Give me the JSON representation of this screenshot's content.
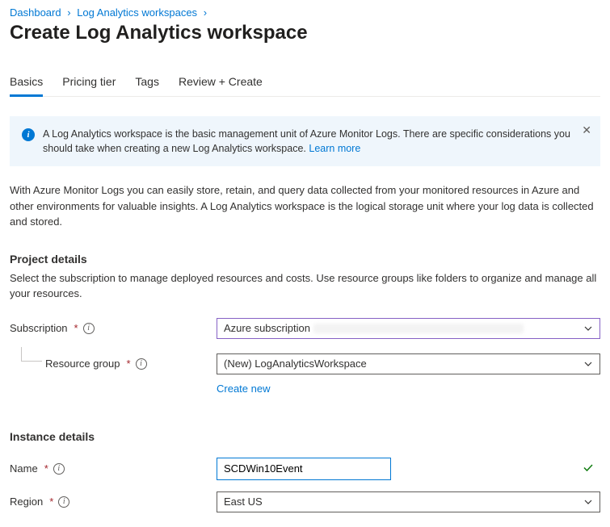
{
  "breadcrumb": {
    "items": [
      {
        "label": "Dashboard"
      },
      {
        "label": "Log Analytics workspaces"
      }
    ]
  },
  "page_title": "Create Log Analytics workspace",
  "tabs": [
    {
      "label": "Basics",
      "active": true
    },
    {
      "label": "Pricing tier"
    },
    {
      "label": "Tags"
    },
    {
      "label": "Review + Create"
    }
  ],
  "infobox": {
    "text": "A Log Analytics workspace is the basic management unit of Azure Monitor Logs. There are specific considerations you should take when creating a new Log Analytics workspace.",
    "link_label": "Learn more"
  },
  "intro": "With Azure Monitor Logs you can easily store, retain, and query data collected from your monitored resources in Azure and other environments for valuable insights. A Log Analytics workspace is the logical storage unit where your log data is collected and stored.",
  "project_details": {
    "title": "Project details",
    "subtitle": "Select the subscription to manage deployed resources and costs. Use resource groups like folders to organize and manage all your resources.",
    "subscription_label": "Subscription",
    "subscription_value": "Azure subscription",
    "resource_group_label": "Resource group",
    "resource_group_value": "(New) LogAnalyticsWorkspace",
    "create_new_label": "Create new"
  },
  "instance_details": {
    "title": "Instance details",
    "name_label": "Name",
    "name_value": "SCDWin10Event",
    "region_label": "Region",
    "region_value": "East US"
  }
}
